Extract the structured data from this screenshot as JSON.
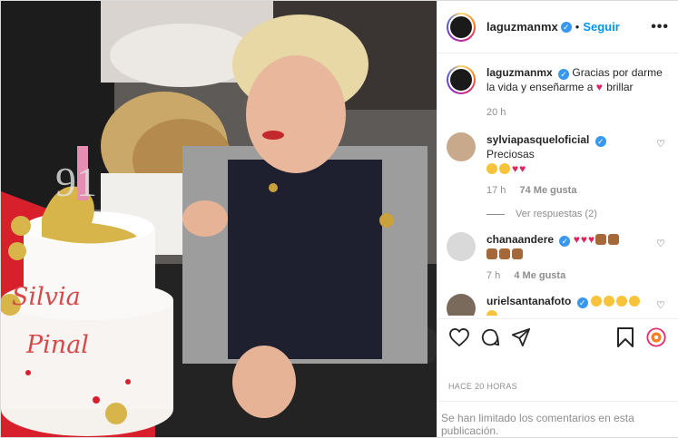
{
  "post": {
    "username": "laguzmanmx",
    "follow_label": "Seguir",
    "more_label": "•••",
    "caption_text": "Gracias por darme la vida y enseñarme a",
    "caption_tail": "brillar",
    "caption_time": "20 h"
  },
  "comments": [
    {
      "username": "sylviapasqueloficial",
      "text": "Preciosas",
      "time": "17 h",
      "likes": "74 Me gusta",
      "replies": "Ver respuestas (2)"
    },
    {
      "username": "chanaandere",
      "time": "7 h",
      "likes": "4 Me gusta"
    },
    {
      "username": "urielsantanafoto"
    }
  ],
  "footer": {
    "posted_ago": "HACE 20 HORAS",
    "limited_notice": "Se han limitado los comentarios en esta publicación."
  },
  "photo": {
    "cake_text_line1": "Silvia",
    "cake_text_line2": "Pinal",
    "candle_text": "91"
  },
  "colors": {
    "accent": "#0095f6",
    "verified": "#3897f0",
    "heart": "#e0245e"
  },
  "icons": [
    "verified-icon",
    "more-options-icon",
    "like-icon",
    "comment-icon",
    "share-icon",
    "save-icon",
    "special-badge-icon",
    "heart-outline-icon"
  ]
}
